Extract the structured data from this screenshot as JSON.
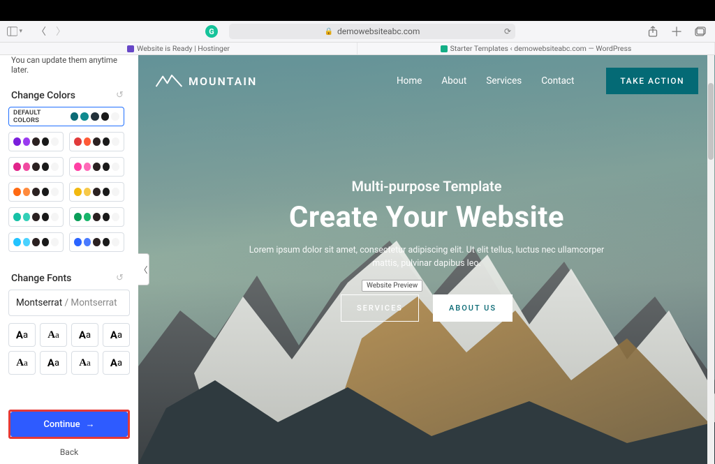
{
  "browser": {
    "url": "demowebsiteabc.com",
    "tabs": [
      {
        "title": "Website is Ready | Hostinger"
      },
      {
        "title": "Starter Templates ‹ demowebsiteabc.com — WordPress"
      }
    ]
  },
  "sidebar": {
    "note": "You can update them anytime later.",
    "colors_title": "Change Colors",
    "default_label": "DEFAULT COLORS",
    "default_palette": [
      "#0b6a75",
      "#0f8a8f",
      "#22313a",
      "#1a1a1a",
      "#f5f5f5"
    ],
    "palettes": [
      [
        [
          "#7a1fdc",
          "#9a3bf0",
          "#2b2121",
          "#1a1a1a",
          "#f5f5f5"
        ],
        [
          "#e13b3b",
          "#ff5a36",
          "#2b2121",
          "#1a1a1a",
          "#f5f5f5"
        ]
      ],
      [
        [
          "#e0248a",
          "#f04aa0",
          "#2b2121",
          "#1a1a1a",
          "#f5f5f5"
        ],
        [
          "#ff3fa4",
          "#ff6ab8",
          "#2b2121",
          "#1a1a1a",
          "#f5f5f5"
        ]
      ],
      [
        [
          "#ff6a13",
          "#ff8a3d",
          "#2b2121",
          "#1a1a1a",
          "#f5f5f5"
        ],
        [
          "#f2b90f",
          "#f7c948",
          "#2b2121",
          "#1a1a1a",
          "#f5f5f5"
        ]
      ],
      [
        [
          "#16c1a6",
          "#33d0b8",
          "#2b2121",
          "#1a1a1a",
          "#f5f5f5"
        ],
        [
          "#0a9d58",
          "#17b56a",
          "#2b2121",
          "#1a1a1a",
          "#f5f5f5"
        ]
      ],
      [
        [
          "#22c3ff",
          "#4ad2ff",
          "#2b2121",
          "#1a1a1a",
          "#f5f5f5"
        ],
        [
          "#2b64ff",
          "#4a7bff",
          "#2b2121",
          "#1a1a1a",
          "#f5f5f5"
        ]
      ]
    ],
    "fonts_title": "Change Fonts",
    "font_selected_1": "Montserrat",
    "font_selected_2": " / Montserrat",
    "font_options": [
      "Aa",
      "Aa",
      "Aa",
      "Aa",
      "Aa",
      "Aa",
      "Aa",
      "Aa"
    ],
    "continue_label": "Continue",
    "back_label": "Back"
  },
  "preview": {
    "tooltip": "Website Preview",
    "brand": "MOUNTAIN",
    "nav": {
      "home": "Home",
      "about": "About",
      "services": "Services",
      "contact": "Contact",
      "cta": "TAKE ACTION"
    },
    "eyebrow": "Multi-purpose Template",
    "headline": "Create Your Website",
    "lede": "Lorem ipsum dolor sit amet, consectetur adipiscing elit. Ut elit tellus, luctus nec ullamcorper mattis, pulvinar dapibus leo.",
    "btn_services": "SERVICES",
    "btn_about": "ABOUT US"
  }
}
